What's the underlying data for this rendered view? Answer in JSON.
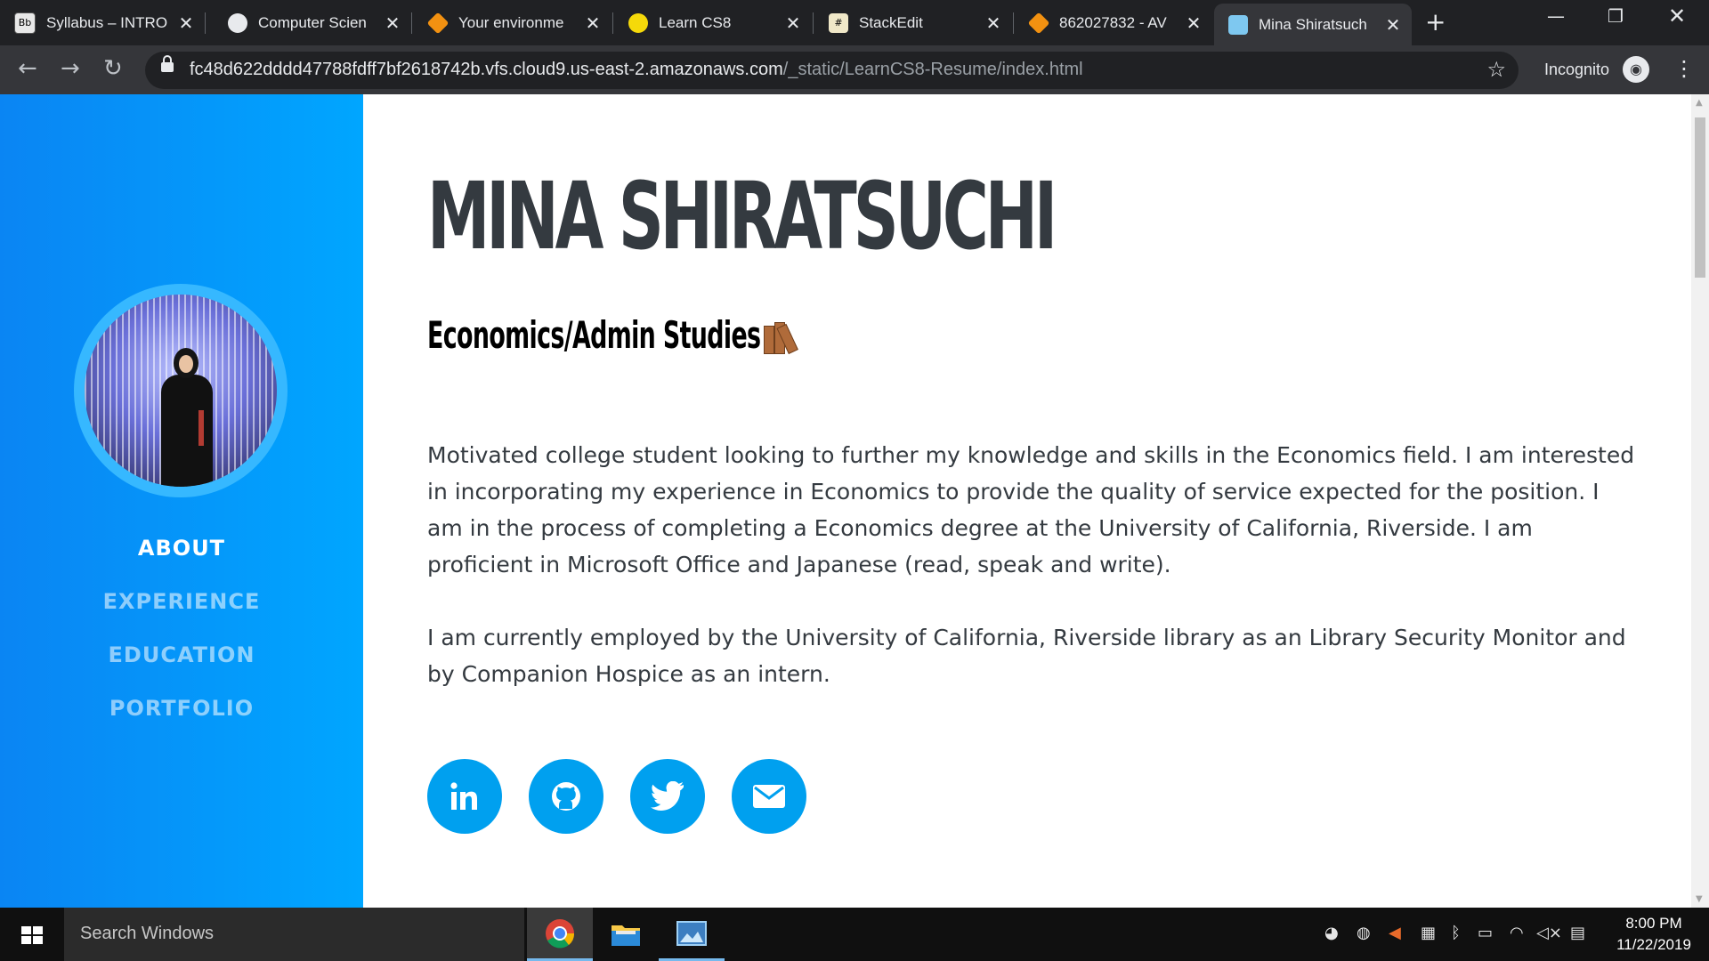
{
  "browser": {
    "tabs": [
      {
        "title": "Syllabus – INTRO",
        "favicon": "Bb"
      },
      {
        "title": "Computer Scien",
        "favicon": ""
      },
      {
        "title": "Your environme",
        "favicon": ""
      },
      {
        "title": "Learn CS8",
        "favicon": ""
      },
      {
        "title": "StackEdit",
        "favicon": "#"
      },
      {
        "title": "862027832 - AV",
        "favicon": ""
      },
      {
        "title": "Mina Shiratsuch",
        "favicon": ""
      }
    ],
    "url_host": "fc48d622dddd47788fdff7bf2618742b.vfs.cloud9.us-east-2.amazonaws.com",
    "url_path": "/_static/LearnCS8-Resume/index.html",
    "incognito_label": "Incognito"
  },
  "sidebar": {
    "nav": [
      {
        "label": "ABOUT"
      },
      {
        "label": "EXPERIENCE"
      },
      {
        "label": "EDUCATION"
      },
      {
        "label": "PORTFOLIO"
      }
    ]
  },
  "main": {
    "name": "MINA SHIRATSUCHI",
    "subtitle": "Economics/Admin Studies",
    "paragraph1": "Motivated college student looking to further my knowledge and skills in the Economics field. I am interested in incorporating my experience in Economics to provide the quality of service expected for the position. I am in the process of completing a Economics degree at the University of California, Riverside. I am proficient in Microsoft Office and Japanese (read, speak and write).",
    "paragraph2": "I am currently employed by the University of California, Riverside library as an Library Security Monitor and by Companion Hospice as an intern.",
    "social_icons": [
      "linkedin-icon",
      "github-icon",
      "twitter-icon",
      "email-icon"
    ]
  },
  "taskbar": {
    "search_placeholder": "Search Windows",
    "time": "8:00 PM",
    "date": "11/22/2019"
  },
  "colors": {
    "sidebar_start": "#0a85f3",
    "sidebar_end": "#00a6ff",
    "social_button": "#00a0ef",
    "heading": "#343a40"
  }
}
